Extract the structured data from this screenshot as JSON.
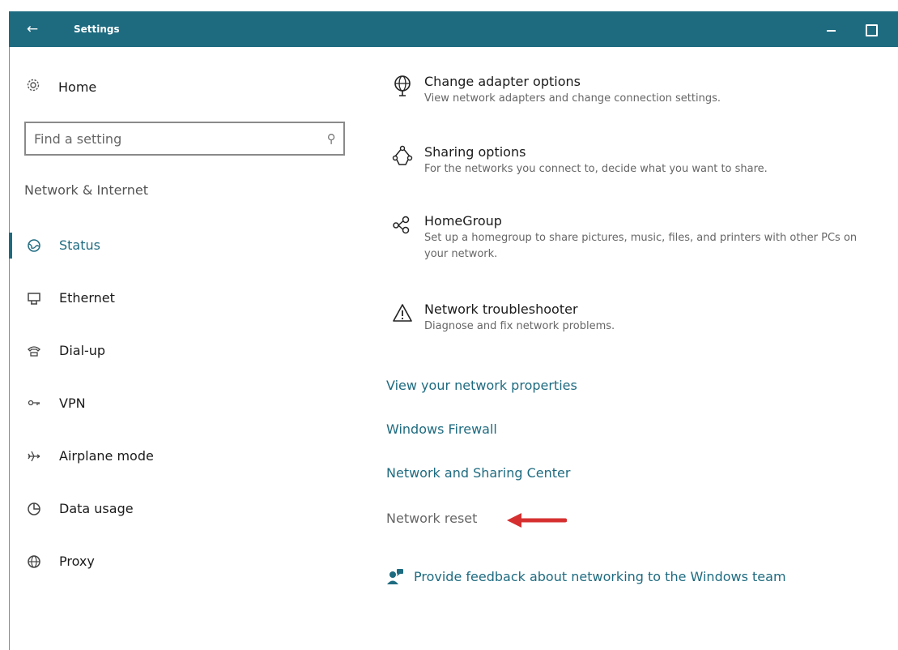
{
  "window": {
    "title": "Settings",
    "back_icon": "back-arrow-icon",
    "accent": "#1e6b80"
  },
  "sidebar": {
    "home_label": "Home",
    "search_placeholder": "Find a setting",
    "section_title": "Network & Internet",
    "items": [
      {
        "label": "Status",
        "icon": "globe-icon",
        "active": true
      },
      {
        "label": "Ethernet",
        "icon": "ethernet-icon",
        "active": false
      },
      {
        "label": "Dial-up",
        "icon": "phone-icon",
        "active": false
      },
      {
        "label": "VPN",
        "icon": "vpn-icon",
        "active": false
      },
      {
        "label": "Airplane mode",
        "icon": "airplane-icon",
        "active": false
      },
      {
        "label": "Data usage",
        "icon": "pie-chart-icon",
        "active": false
      },
      {
        "label": "Proxy",
        "icon": "globe-grid-icon",
        "active": false
      }
    ]
  },
  "main": {
    "options": [
      {
        "title": "Change adapter options",
        "desc": "View network adapters and change connection settings.",
        "icon": "adapter-globe-icon"
      },
      {
        "title": "Sharing options",
        "desc": "For the networks you connect to, decide what you want to share.",
        "icon": "share-icon"
      },
      {
        "title": "HomeGroup",
        "desc": "Set up a homegroup to share pictures, music, files, and printers with other PCs on your network.",
        "icon": "homegroup-icon"
      },
      {
        "title": "Network troubleshooter",
        "desc": "Diagnose and fix network problems.",
        "icon": "warning-icon"
      }
    ],
    "links": {
      "properties": "View your network properties",
      "firewall": "Windows Firewall",
      "sharing_center": "Network and Sharing Center",
      "reset": "Network reset"
    },
    "feedback_label": "Provide feedback about networking to the Windows team",
    "arrow_color": "#d62f2f"
  }
}
